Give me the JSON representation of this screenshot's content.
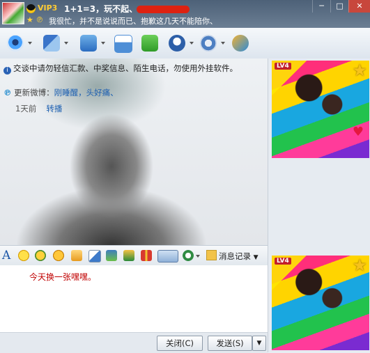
{
  "titlebar": {
    "vip": "VIP3",
    "nickname": "1+1=3，玩不起、",
    "signature": "我很忙，并不是说说而已、抱歉这几天不能陪你、",
    "minimize": "─",
    "maximize": "□",
    "close": "✕"
  },
  "chat": {
    "warning": "交谈中请勿轻信汇款、中奖信息、陌生电话，勿使用外挂软件。",
    "weibo_prefix": "更新微博：",
    "weibo_text": "刚睡醒，头好痛、",
    "weibo_time": "1天前",
    "weibo_repost": "转播"
  },
  "format_bar": {
    "font_glyph": "A",
    "history_label": "消息记录"
  },
  "input": {
    "text": "今天换一张嘿嘿。"
  },
  "buttons": {
    "close": "关闭(C)",
    "send": "发送(S)"
  },
  "sidebar": {
    "top_level": "LV4",
    "bottom_level": "LV4"
  }
}
